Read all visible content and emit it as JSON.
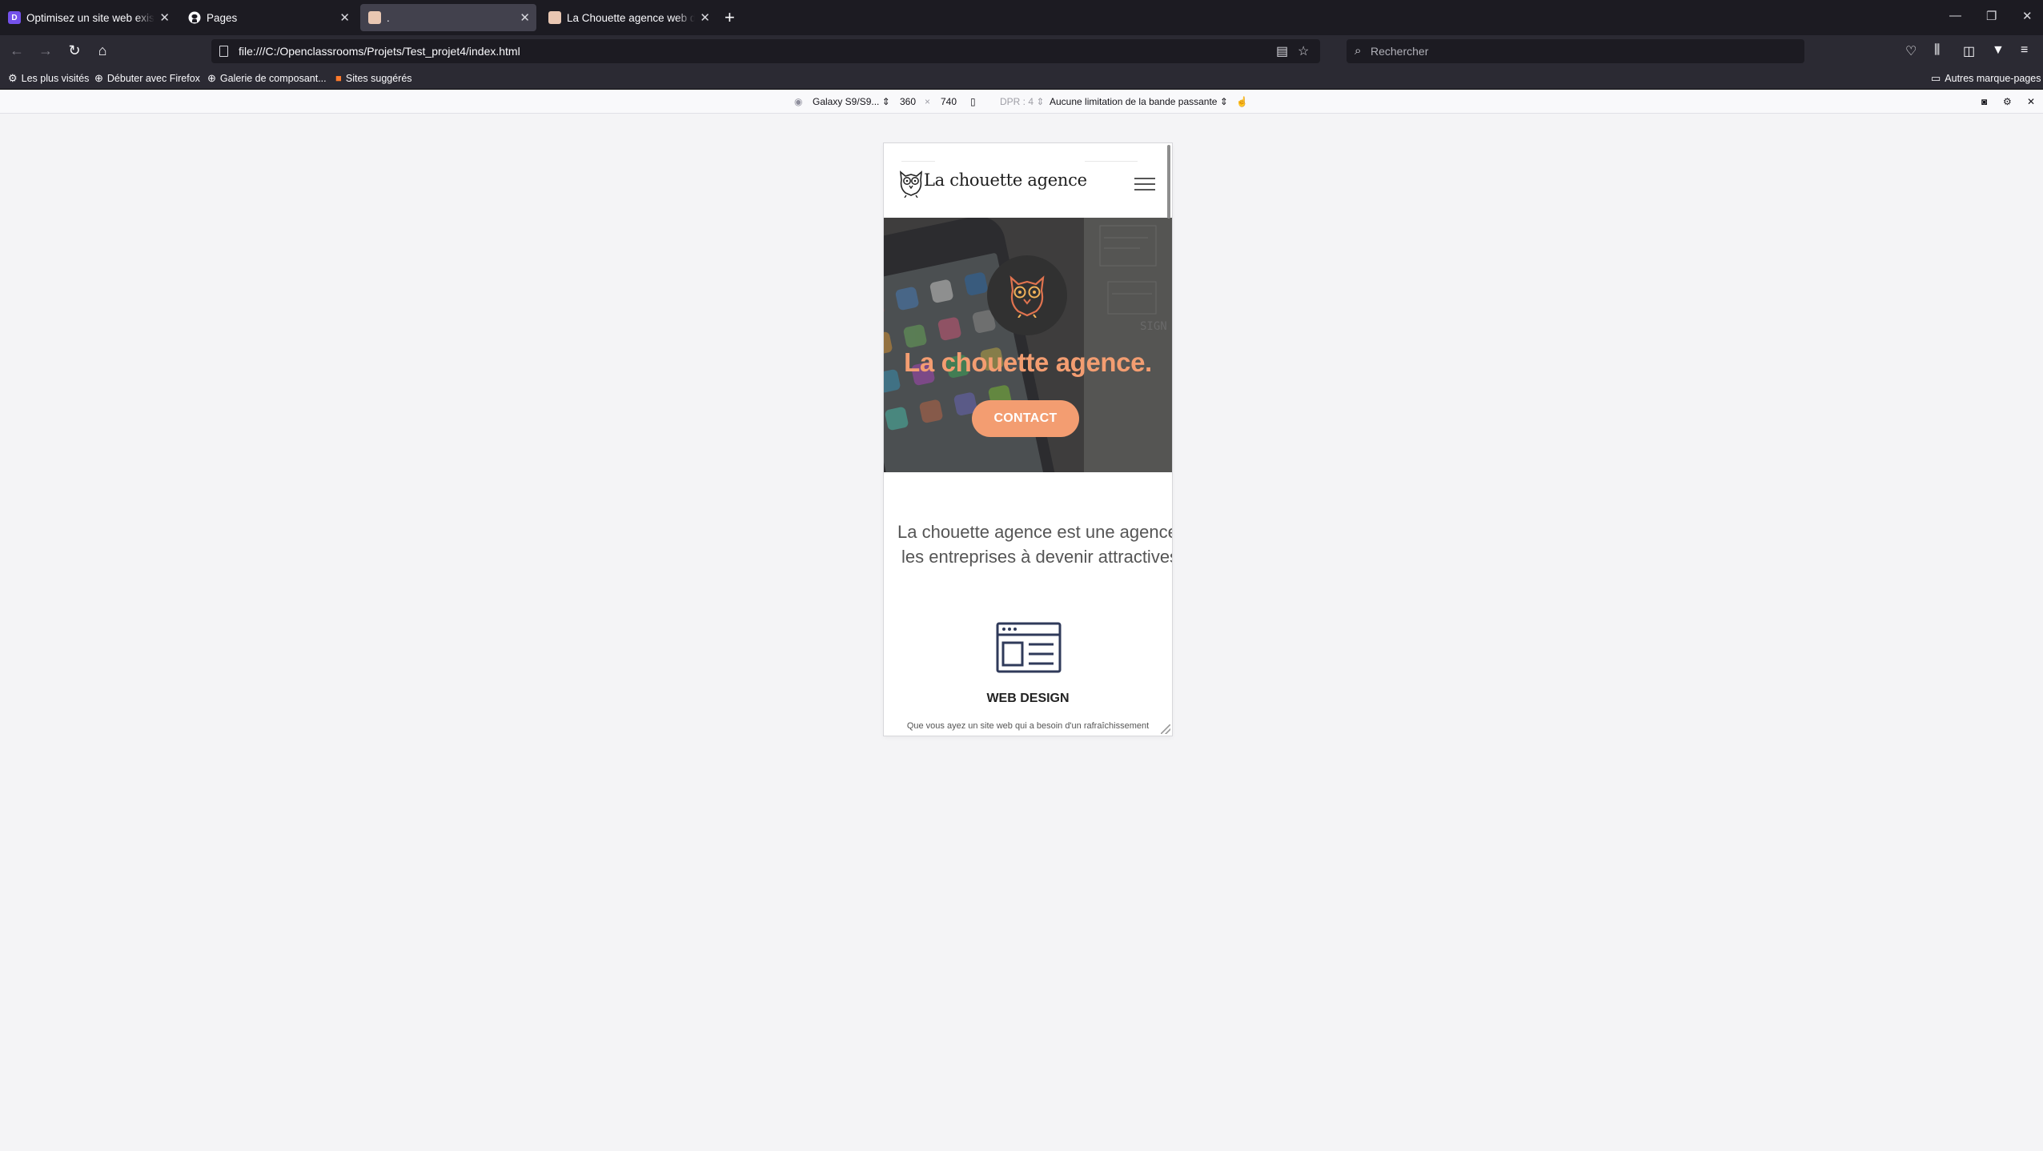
{
  "browser": {
    "tabs": [
      {
        "title": "Optimisez un site web existant",
        "favicon": "openclassrooms-icon",
        "active": false
      },
      {
        "title": "Pages",
        "favicon": "github-icon",
        "active": false
      },
      {
        "title": ".",
        "favicon": "owl-favicon",
        "active": true
      },
      {
        "title": "La Chouette agence web design",
        "favicon": "owl-favicon",
        "active": false
      }
    ],
    "new_tab_label": "+",
    "url": "file:///C:/Openclassrooms/Projets/Test_projet4/index.html",
    "search_placeholder": "Rechercher",
    "bookmarks": [
      {
        "label": "Les plus visités",
        "icon": "gear-icon"
      },
      {
        "label": "Débuter avec Firefox",
        "icon": "globe-icon"
      },
      {
        "label": "Galerie de composant...",
        "icon": "globe-icon"
      },
      {
        "label": "Sites suggérés",
        "icon": "fire-icon"
      }
    ],
    "other_bookmarks": "Autres marque-pages"
  },
  "responsive_toolbar": {
    "device": "Galaxy S9/S9...",
    "width": "360",
    "times": "×",
    "height": "740",
    "dpr": "DPR : 4",
    "throttling": "Aucune limitation de la bande passante"
  },
  "site": {
    "brand": "La chouette agence",
    "hero_title": "La chouette agence.",
    "contact_button": "CONTACT",
    "about_line1": "La chouette agence est une agence",
    "about_line2": "les entreprises à devenir attractives",
    "service_title": "WEB DESIGN",
    "service_text": "Que vous ayez un site web qui a besoin d'un rafraîchissement",
    "accent_color": "#f39d71"
  }
}
